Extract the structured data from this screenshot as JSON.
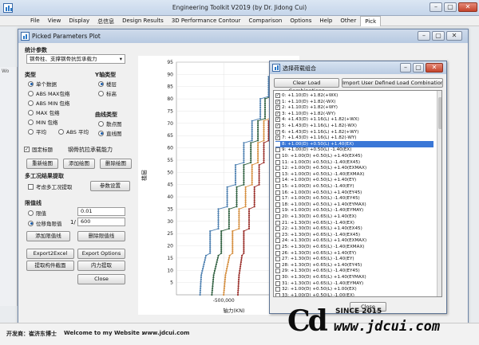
{
  "app": {
    "title": "Engineering Toolkit V2019 (by Dr. Jidong Cui)",
    "menu": [
      "File",
      "View",
      "Display",
      "总信息",
      "Design Results",
      "3D Performance Contour",
      "Comparison",
      "Options",
      "Help",
      "Other",
      "Pick"
    ],
    "active_menu": "Pick",
    "side_label": "Wo"
  },
  "picked_window": {
    "title": "Picked Parameters Plot",
    "stat_group": "统计参数",
    "stat_select": "钢骨柱、支撑钢骨抗剪承载力",
    "type_group": "类型",
    "type_options": [
      "单个数据",
      "ABS MAX包络",
      "ABS MIN 包络",
      "MAX 包络",
      "MIN 包络",
      "平均",
      "ABS 平均"
    ],
    "y_group": "Y轴类型",
    "y_options": [
      "楼层",
      "标高"
    ],
    "curve_group": "曲线类型",
    "curve_options": [
      "散点图",
      "直线图"
    ],
    "fix_title_label": "固定标题",
    "fix_title_value": "钢骨抗拉承载能力",
    "btn_redraw": "重新绘图",
    "btn_add": "添加绘图",
    "btn_delete": "删除绘图",
    "multi_group": "多工况结果提取",
    "consider_multi": "考虑多工况提取",
    "btn_params": "参数设置",
    "limit_group": "限值线",
    "limit_value_label": "限值",
    "limit_value": "0.01",
    "drift_label": "位移角限值",
    "drift_prefix": "1/",
    "drift_value": "600",
    "btn_add_limit": "添加限值线",
    "btn_del_limit": "删除限值线",
    "btn_export_excel": "Export2Excel",
    "btn_export_options": "Export Options",
    "btn_extract": "提取构件截面",
    "btn_internal": "内力提取",
    "btn_close": "Close"
  },
  "chart_data": {
    "type": "line",
    "xlabel": "轴力(KN)",
    "ylabel": "楼层",
    "xtick_labels": [
      "-500,000",
      "0"
    ],
    "xticks": [
      -500000,
      0
    ],
    "xlim": [
      -900000,
      100000
    ],
    "yticks": [
      5,
      10,
      15,
      20,
      25,
      30,
      35,
      40,
      45,
      50,
      55,
      60,
      65,
      70,
      75,
      80,
      85,
      90,
      95
    ],
    "ylim": [
      0,
      95
    ],
    "floors": [
      0,
      8,
      16,
      17,
      26,
      27,
      35,
      36,
      44,
      45,
      53,
      54,
      62,
      63,
      71,
      72,
      80,
      81,
      89,
      90,
      95
    ],
    "series": [
      {
        "color": "#4c7fb0",
        "values": [
          -700000,
          -690000,
          -650000,
          -615000,
          -615000,
          -545000,
          -545000,
          -470000,
          -470000,
          -400000,
          -400000,
          -330000,
          -330000,
          -260000,
          -260000,
          -190000,
          -190000,
          -120000,
          -120000,
          -60000,
          -20000
        ]
      },
      {
        "color": "#d58d3c",
        "values": [
          -500000,
          -485000,
          -450000,
          -425000,
          -425000,
          -370000,
          -370000,
          -315000,
          -315000,
          -260000,
          -260000,
          -210000,
          -210000,
          -160000,
          -160000,
          -110000,
          -110000,
          -70000,
          -70000,
          -30000,
          -10000
        ]
      },
      {
        "color": "#9a2f2a",
        "values": [
          -380000,
          -370000,
          -345000,
          -330000,
          -330000,
          -285000,
          -285000,
          -240000,
          -240000,
          -200000,
          -200000,
          -160000,
          -160000,
          -120000,
          -120000,
          -80000,
          -80000,
          -50000,
          -50000,
          -20000,
          -5000
        ]
      },
      {
        "color": "#2e5f3f",
        "values": [
          -600000,
          -585000,
          -545000,
          -520000,
          -520000,
          -455000,
          -455000,
          -390000,
          -390000,
          -330000,
          -330000,
          -270000,
          -270000,
          -210000,
          -210000,
          -150000,
          -150000,
          -95000,
          -95000,
          -45000,
          -15000
        ]
      }
    ]
  },
  "dialog": {
    "title": "选择荷载组合",
    "btn_clear": "Clear Load Combinations",
    "btn_import": "Import User Defined Load Combinations",
    "items": [
      {
        "checked": true,
        "text": "0: +1.10(D) +1.82(+WX)"
      },
      {
        "checked": true,
        "text": "1: +1.10(D) +1.82(-WX)"
      },
      {
        "checked": true,
        "text": "2: +1.10(D) +1.82(+WY)"
      },
      {
        "checked": true,
        "text": "3: +1.10(D) +1.82(-WY)"
      },
      {
        "checked": true,
        "text": "4: +1.43(D) +1.16(L) +1.82(+WX)"
      },
      {
        "checked": true,
        "text": "5: +1.43(D) +1.16(L) +1.82(-WX)"
      },
      {
        "checked": true,
        "text": "6: +1.43(D) +1.16(L) +1.82(+WY)"
      },
      {
        "checked": true,
        "text": "7: +1.43(D) +1.16(L) +1.82(-WY)"
      },
      {
        "checked": false,
        "text": "8: +1.00(D) +0.50(L) +1.40(EX)",
        "selected": true
      },
      {
        "checked": false,
        "text": "9: +1.00(D) +0.50(L) -1.40(EX)"
      },
      {
        "checked": false,
        "text": "10: +1.00(D) +0.50(L) +1.40(EX45)"
      },
      {
        "checked": false,
        "text": "11: +1.00(D) +0.50(L) -1.40(EX45)"
      },
      {
        "checked": false,
        "text": "12: +1.00(D) +0.50(L) +1.40(EXMAX)"
      },
      {
        "checked": false,
        "text": "13: +1.00(D) +0.50(L) -1.40(EXMAX)"
      },
      {
        "checked": false,
        "text": "14: +1.00(D) +0.50(L) +1.40(EY)"
      },
      {
        "checked": false,
        "text": "15: +1.00(D) +0.50(L) -1.40(EY)"
      },
      {
        "checked": false,
        "text": "16: +1.00(D) +0.50(L) +1.40(EY45)"
      },
      {
        "checked": false,
        "text": "17: +1.00(D) +0.50(L) -1.40(EY45)"
      },
      {
        "checked": false,
        "text": "18: +1.00(D) +0.50(L) +1.40(EYMAX)"
      },
      {
        "checked": false,
        "text": "19: +1.00(D) +0.50(L) -1.40(EYMAY)"
      },
      {
        "checked": false,
        "text": "20: +1.30(D) +0.65(L) +1.40(EX)"
      },
      {
        "checked": false,
        "text": "21: +1.30(D) +0.65(L) -1.40(EX)"
      },
      {
        "checked": false,
        "text": "22: +1.30(D) +0.65(L) +1.40(EX45)"
      },
      {
        "checked": false,
        "text": "23: +1.30(D) +0.65(L) -1.40(EX45)"
      },
      {
        "checked": false,
        "text": "24: +1.30(D) +0.65(L) +1.40(EXMAX)"
      },
      {
        "checked": false,
        "text": "25: +1.30(D) +0.65(L) -1.40(EXMAX)"
      },
      {
        "checked": false,
        "text": "26: +1.30(D) +0.65(L) +1.40(EY)"
      },
      {
        "checked": false,
        "text": "27: +1.30(D) +0.65(L) -1.40(EY)"
      },
      {
        "checked": false,
        "text": "28: +1.30(D) +0.65(L) +1.40(EY45)"
      },
      {
        "checked": false,
        "text": "29: +1.30(D) +0.65(L) -1.40(EY45)"
      },
      {
        "checked": false,
        "text": "30: +1.30(D) +0.65(L) +1.40(EYMAX)"
      },
      {
        "checked": false,
        "text": "31: +1.30(D) +0.65(L) -1.40(EYMAY)"
      },
      {
        "checked": false,
        "text": "32: +1.00(D) +0.50(L) +1.00(EX)"
      },
      {
        "checked": false,
        "text": "33: +1.00(D) +0.50(L) -1.00(EX)"
      }
    ],
    "btn_close": "Close"
  },
  "status": {
    "developer": "开发商：崔济东博士",
    "welcome": "Welcome to my Website :",
    "website": "www.jdcui.com"
  },
  "watermark": {
    "logo": "Cd",
    "since": "SINCE 2015",
    "url": "www.jdcui.com"
  }
}
